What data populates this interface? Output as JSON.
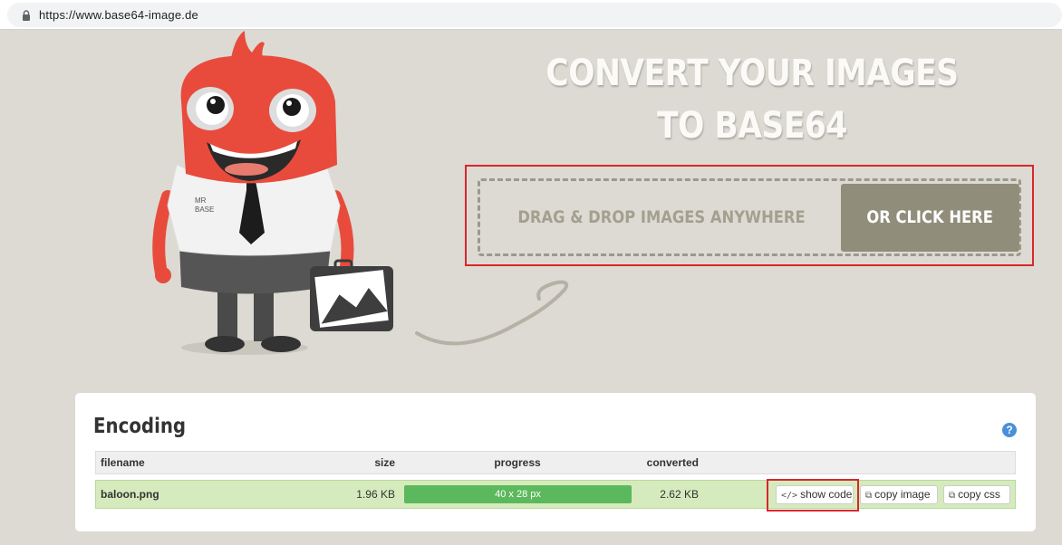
{
  "browser": {
    "url": "https://www.base64-image.de"
  },
  "hero": {
    "title_line1": "CONVERT YOUR IMAGES",
    "title_line2": "TO BASE64",
    "drop_text": "DRAG & DROP IMAGES ANYWHERE",
    "click_label": "OR CLICK HERE"
  },
  "mascot": {
    "shirt_text_line1": "MR",
    "shirt_text_line2": "BASE"
  },
  "encoding": {
    "title": "Encoding",
    "help_label": "?",
    "columns": [
      "filename",
      "size",
      "progress",
      "converted"
    ],
    "rows": [
      {
        "filename": "baloon.png",
        "size": "1.96 KB",
        "progress_text": "40 x 28 px",
        "progress": 1.0,
        "converted": "2.62 KB",
        "actions": {
          "show_code": "show code",
          "copy_image": "copy image",
          "copy_css": "copy css"
        }
      }
    ]
  },
  "colors": {
    "background": "#dcdad3",
    "highlight": "#d9262d",
    "click_button": "#908e7b",
    "progress": "#5cb85c",
    "row_success": "#d6ebbd"
  }
}
